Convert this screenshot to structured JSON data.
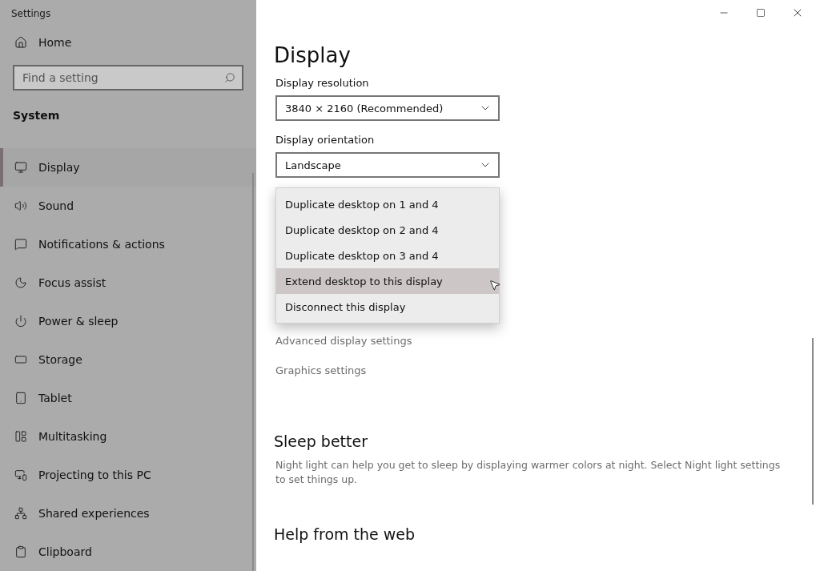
{
  "window": {
    "title": "Settings"
  },
  "sidebar": {
    "home": "Home",
    "search": {
      "placeholder": "Find a setting"
    },
    "section": "System",
    "items": [
      {
        "label": "Display",
        "selected": true
      },
      {
        "label": "Sound",
        "selected": false
      },
      {
        "label": "Notifications & actions",
        "selected": false
      },
      {
        "label": "Focus assist",
        "selected": false
      },
      {
        "label": "Power & sleep",
        "selected": false
      },
      {
        "label": "Storage",
        "selected": false
      },
      {
        "label": "Tablet",
        "selected": false
      },
      {
        "label": "Multitasking",
        "selected": false
      },
      {
        "label": "Projecting to this PC",
        "selected": false
      },
      {
        "label": "Shared experiences",
        "selected": false
      },
      {
        "label": "Clipboard",
        "selected": false
      }
    ]
  },
  "main": {
    "title": "Display",
    "fields": [
      {
        "label": "Display resolution",
        "value": "3840 × 2160 (Recommended)"
      },
      {
        "label": "Display orientation",
        "value": "Landscape"
      }
    ],
    "menu": [
      {
        "label": "Duplicate desktop on 1 and 4",
        "selected": false
      },
      {
        "label": "Duplicate desktop on 2 and 4",
        "selected": false
      },
      {
        "label": "Duplicate desktop on 3 and 4",
        "selected": false
      },
      {
        "label": "Extend desktop to this display",
        "selected": true
      },
      {
        "label": "Disconnect this display",
        "selected": false
      }
    ],
    "links": [
      "Advanced display settings",
      "Graphics settings"
    ],
    "sections": [
      {
        "heading": "Sleep better",
        "text": "Night light can help you get to sleep by displaying warmer colors at night. Select Night light settings to set things up."
      },
      {
        "heading": "Help from the web"
      }
    ]
  }
}
